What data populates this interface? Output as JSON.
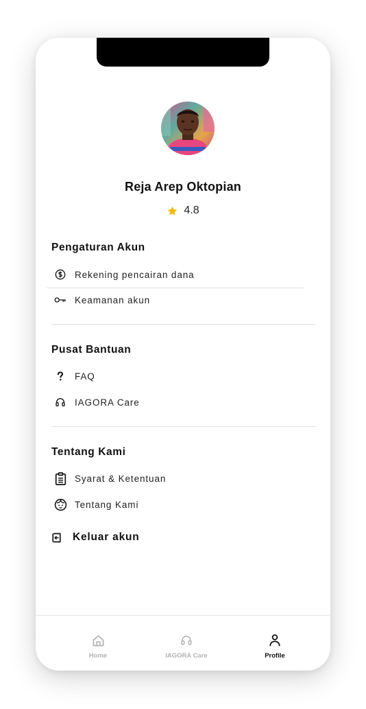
{
  "profile": {
    "name": "Reja Arep Oktopian",
    "rating": "4.8"
  },
  "sections": [
    {
      "title": "Pengaturan Akun",
      "items": [
        {
          "label": "Rekening pencairan dana",
          "icon": "dollar-circle-icon"
        },
        {
          "label": "Keamanan akun",
          "icon": "key-icon"
        }
      ]
    },
    {
      "title": "Pusat Bantuan",
      "items": [
        {
          "label": "FAQ",
          "icon": "question-mark-icon"
        },
        {
          "label": "IAGORA Care",
          "icon": "headset-icon"
        }
      ]
    },
    {
      "title": "Tentang Kami",
      "items": [
        {
          "label": "Syarat & Ketentuan",
          "icon": "clipboard-icon"
        },
        {
          "label": "Tentang Kami",
          "icon": "face-icon"
        }
      ]
    }
  ],
  "logout": {
    "label": "Keluar akun",
    "icon": "logout-icon"
  },
  "bottom_nav": [
    {
      "label": "Home",
      "icon": "home-icon",
      "active": false
    },
    {
      "label": "IAGORA Care",
      "icon": "headset-icon",
      "active": false
    },
    {
      "label": "Profile",
      "icon": "person-icon",
      "active": true
    }
  ],
  "colors": {
    "star": "#F5B800",
    "text": "#111111",
    "inactive_nav": "#B3B3B3",
    "divider": "#E3E3E3"
  }
}
